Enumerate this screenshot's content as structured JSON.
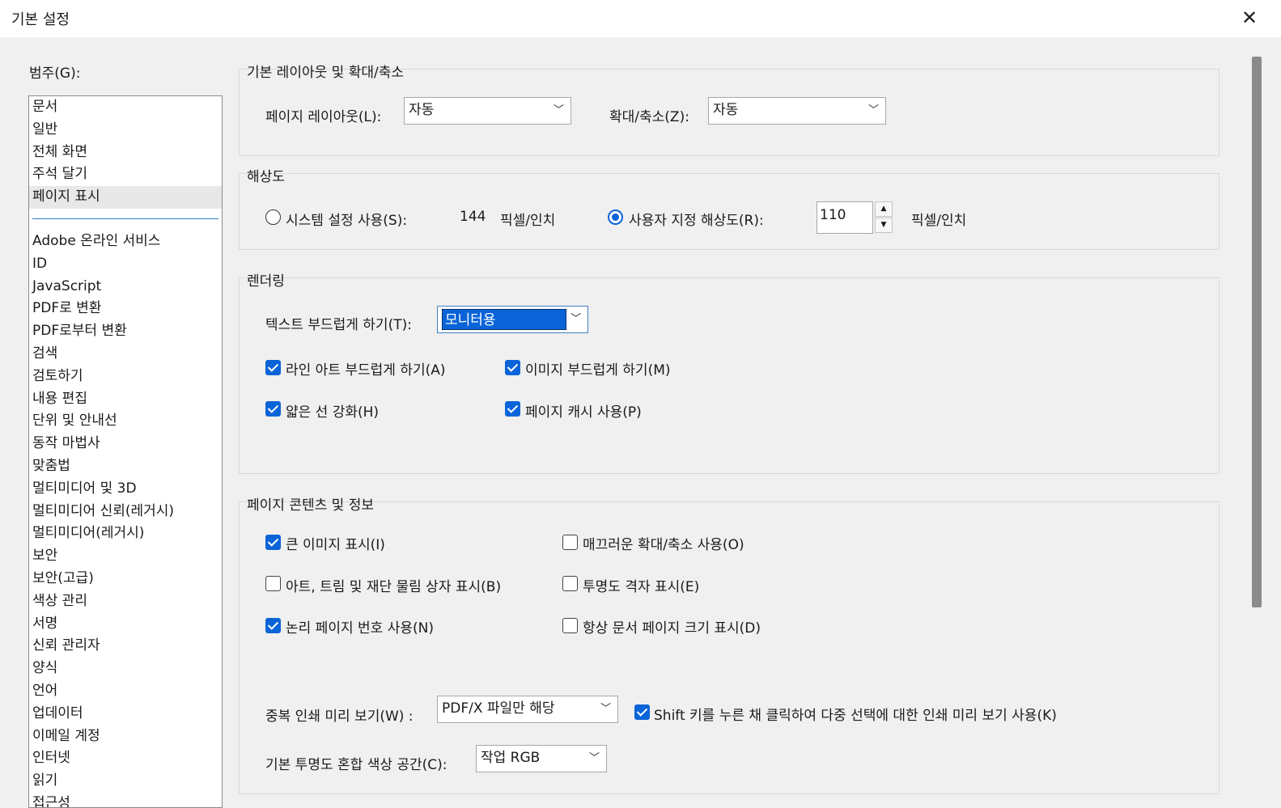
{
  "window": {
    "title": "기본 설정",
    "close_glyph": "✕"
  },
  "categories": {
    "label": "범주(G):",
    "top_items": [
      "문서",
      "일반",
      "전체 화면",
      "주석 달기",
      "페이지 표시"
    ],
    "selected": "페이지 표시",
    "items": [
      "Adobe 온라인 서비스",
      "ID",
      "JavaScript",
      "PDF로 변환",
      "PDF로부터 변환",
      "검색",
      "검토하기",
      "내용 편집",
      "단위 및 안내선",
      "동작 마법사",
      "맞춤법",
      "멀티미디어 및 3D",
      "멀티미디어 신뢰(레거시)",
      "멀티미디어(레거시)",
      "보안",
      "보안(고급)",
      "색상 관리",
      "서명",
      "신뢰 관리자",
      "양식",
      "언어",
      "업데이터",
      "이메일 계정",
      "인터넷",
      "읽기",
      "접근성"
    ]
  },
  "layout_group": {
    "title": "기본 레이아웃 및 확대/축소",
    "page_layout_label": "페이지 레이아웃(L):",
    "page_layout_value": "자동",
    "zoom_label": "확대/축소(Z):",
    "zoom_value": "자동"
  },
  "resolution_group": {
    "title": "해상도",
    "system_label": "시스템 설정 사용(S):",
    "system_value": "144",
    "unit1": "픽셀/인치",
    "custom_label": "사용자 지정 해상도(R):",
    "custom_value": "110",
    "unit2": "픽셀/인치",
    "selected": "custom"
  },
  "rendering_group": {
    "title": "렌더링",
    "smooth_text_label": "텍스트 부드럽게 하기(T):",
    "smooth_text_value": "모니터용",
    "smooth_line_art": {
      "label": "라인 아트 부드럽게 하기(A)",
      "checked": true
    },
    "smooth_images": {
      "label": "이미지 부드럽게 하기(M)",
      "checked": true
    },
    "enhance_thin_lines": {
      "label": "얇은 선 강화(H)",
      "checked": true
    },
    "page_cache": {
      "label": "페이지 캐시 사용(P)",
      "checked": true
    }
  },
  "content_group": {
    "title": "페이지 콘텐츠 및 정보",
    "show_large_images": {
      "label": "큰 이미지 표시(I)",
      "checked": true
    },
    "smooth_zoom": {
      "label": "매끄러운 확대/축소 사용(O)",
      "checked": false
    },
    "show_art_boxes": {
      "label": "아트, 트림 및 재단 물림 상자 표시(B)",
      "checked": false
    },
    "transparency_grid": {
      "label": "투명도 격자 표시(E)",
      "checked": false
    },
    "logical_page_numbers": {
      "label": "논리 페이지 번호 사용(N)",
      "checked": true
    },
    "always_show_page_size": {
      "label": "항상 문서 페이지 크기 표시(D)",
      "checked": false
    },
    "overprint_label": "중복 인쇄 미리 보기(W) :",
    "overprint_value": "PDF/X 파일만 해당",
    "shift_click": {
      "label": "Shift 키를 누른 채 클릭하여 다중 선택에 대한 인쇄 미리 보기 사용(K)",
      "checked": true
    },
    "blend_label": "기본 투명도 혼합 색상 공간(C):",
    "blend_value": "작업 RGB"
  },
  "colors": {
    "accent": "#0a64d8",
    "panel": "#f0f0f0",
    "separator": "#2e7fc2"
  },
  "icons": {
    "dropdown": "chevron-down-icon",
    "spin_up": "▲",
    "spin_down": "▼"
  }
}
